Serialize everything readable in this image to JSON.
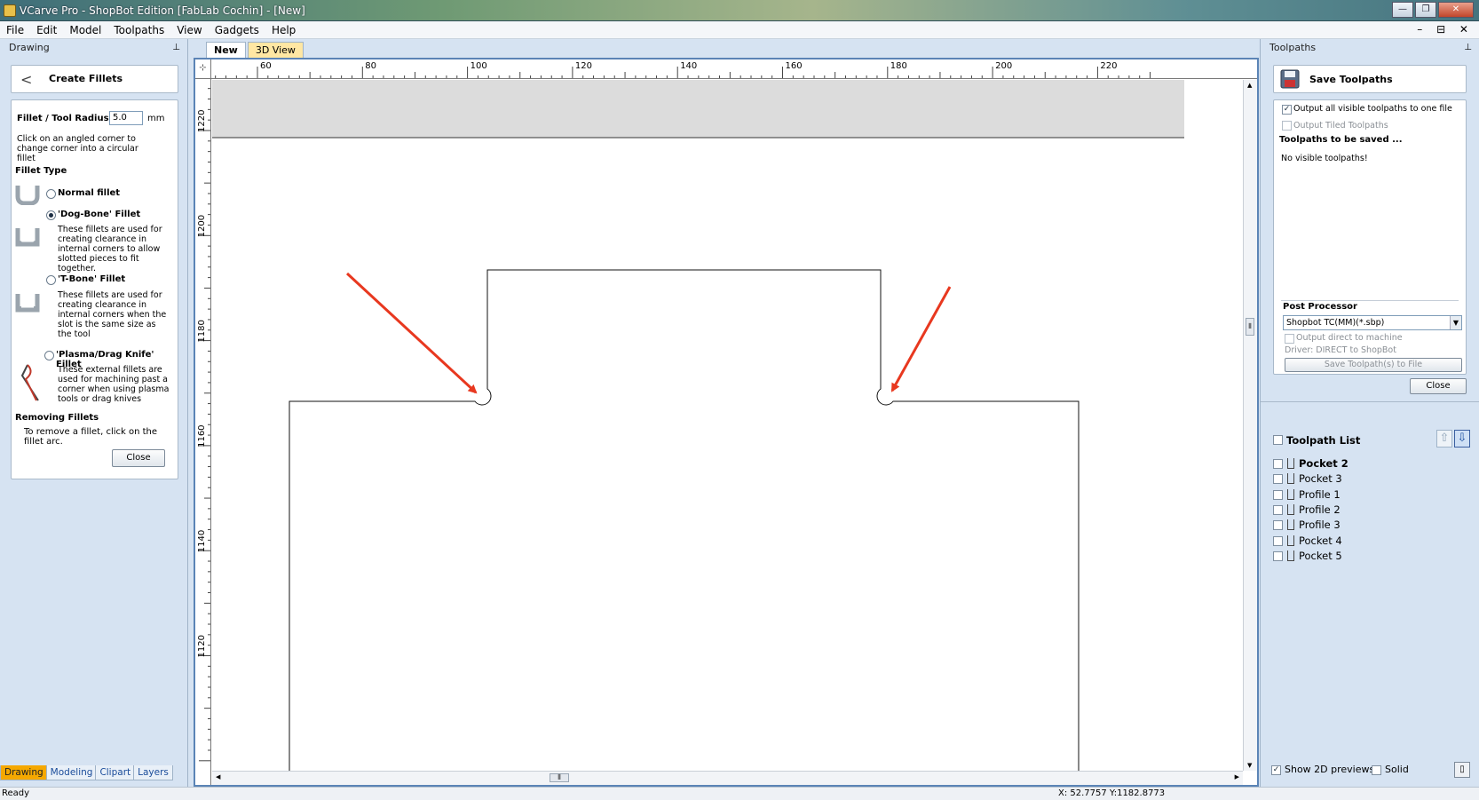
{
  "window": {
    "title": "VCarve Pro - ShopBot Edition [FabLab Cochin] - [New]",
    "controls": [
      "—",
      "❐",
      "✕"
    ]
  },
  "menu": [
    "File",
    "Edit",
    "Model",
    "Toolpaths",
    "View",
    "Gadgets",
    "Help"
  ],
  "mdi_controls": "–  ⊟  ✕",
  "left_panel": {
    "title": "Drawing",
    "pin": "⊥",
    "header": {
      "back": "<",
      "title": "Create Fillets"
    },
    "radius_label": "Fillet / Tool Radius:",
    "radius_value": "5.0",
    "radius_unit": "mm",
    "hint": "Click on an angled corner to change corner into a circular fillet",
    "fillet_type_heading": "Fillet Type",
    "options": [
      {
        "label": "Normal fillet",
        "selected": false,
        "desc": ""
      },
      {
        "label": "'Dog-Bone' Fillet",
        "selected": true,
        "desc": "These fillets are used for creating clearance in internal corners to allow slotted pieces to fit together."
      },
      {
        "label": "'T-Bone' Fillet",
        "selected": false,
        "desc": "These fillets are used for creating clearance in internal corners when the slot is the same size as the tool"
      },
      {
        "label": "'Plasma/Drag Knife' Fillet",
        "selected": false,
        "desc": "These external fillets are used for machining past a corner when using plasma tools or drag knives"
      }
    ],
    "removing_heading": "Removing Fillets",
    "removing_text": "To remove a fillet, click on the fillet arc.",
    "close_label": "Close",
    "tabs": [
      "Drawing",
      "Modeling",
      "Clipart",
      "Layers"
    ],
    "active_tab": "Drawing"
  },
  "document": {
    "tabs": [
      "New",
      "3D View"
    ],
    "active_tab": "New",
    "ruler_x": [
      "60",
      "80",
      "100",
      "120",
      "140",
      "160",
      "180",
      "200",
      "220"
    ],
    "ruler_y": [
      "1220",
      "1200",
      "1180",
      "1160",
      "1140",
      "1120"
    ],
    "scroll_grip": "⦀",
    "corner_glyph": "⊹"
  },
  "right_panel": {
    "title": "Toolpaths",
    "pin": "⊥",
    "header_title": "Save Toolpaths",
    "opt_all_visible": "Output all visible toolpaths to one file",
    "opt_all_visible_checked": true,
    "opt_tiled": "Output Tiled Toolpaths",
    "opt_tiled_checked": false,
    "to_be_saved_heading": "Toolpaths to be saved ...",
    "no_visible": "No visible toolpaths!",
    "post_processor_heading": "Post Processor",
    "post_processor_value": "Shopbot TC(MM)(*.sbp)",
    "output_direct": "Output direct to machine",
    "driver": "Driver: DIRECT to ShopBot",
    "save_button": "Save Toolpath(s) to File",
    "close_label": "Close",
    "toolpath_list_heading": "Toolpath List",
    "toolpaths": [
      "Pocket 2",
      "Pocket 3",
      "Profile 1",
      "Profile 2",
      "Profile 3",
      "Pocket 4",
      "Pocket 5"
    ],
    "bold_index": 0,
    "show_2d_previews": "Show 2D previews",
    "show_2d_checked": true,
    "solid": "Solid",
    "solid_checked": false
  },
  "status": {
    "left": "Ready",
    "coords": "X: 52.7757 Y:1182.8773"
  },
  "colors": {
    "panel_bg": "#d6e3f2",
    "annotation_arrow": "#e8381f",
    "active_tab": "#f5a800"
  }
}
